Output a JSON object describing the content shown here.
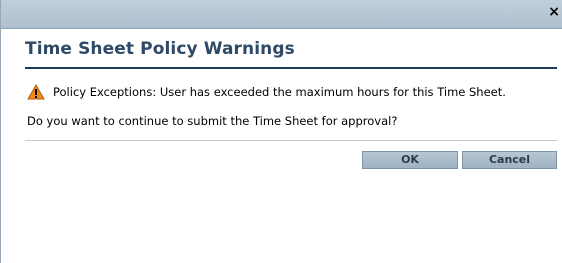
{
  "titlebar": {
    "close_glyph": "×"
  },
  "dialog": {
    "title": "Time Sheet Policy Warnings",
    "warning_icon": "warning-triangle-icon",
    "warning_message": "Policy Exceptions: User has exceeded the maximum hours for this Time Sheet.",
    "question": "Do you want to continue to submit the Time Sheet for approval?"
  },
  "buttons": {
    "ok_label": "OK",
    "cancel_label": "Cancel"
  },
  "colors": {
    "title_text": "#2e4a66",
    "heading_rule": "#1f3a5a",
    "titlebar": "#b6c6d5",
    "button_face": "#a9bac9",
    "warning_fill": "#f08a1c"
  }
}
